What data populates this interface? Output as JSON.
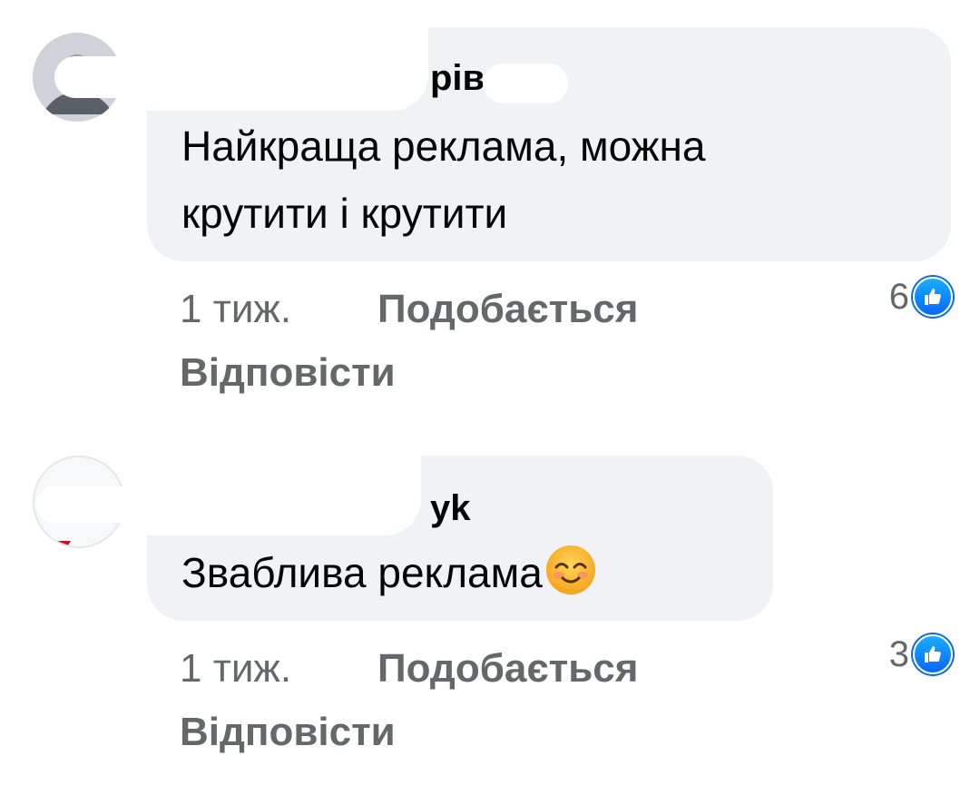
{
  "comments": [
    {
      "author": "рів",
      "text_lines": [
        "Найкраща реклама, можна",
        "крутити і крутити"
      ],
      "time": "1 тиж.",
      "like_label": "Подобається",
      "reply_label": "Відповісти",
      "reaction_count": "6",
      "reaction_icon": "like-icon"
    },
    {
      "author": "yk",
      "text_lines": [
        "Зваблива реклама"
      ],
      "emoji": "smiling-face-with-smiling-eyes",
      "time": "1 тиж.",
      "like_label": "Подобається",
      "reply_label": "Відповісти",
      "reaction_count": "3",
      "reaction_icon": "like-icon"
    }
  ],
  "colors": {
    "bubble_bg": "#f0f2f5",
    "meta_text": "#65676b",
    "like_blue": "#0866ff"
  }
}
